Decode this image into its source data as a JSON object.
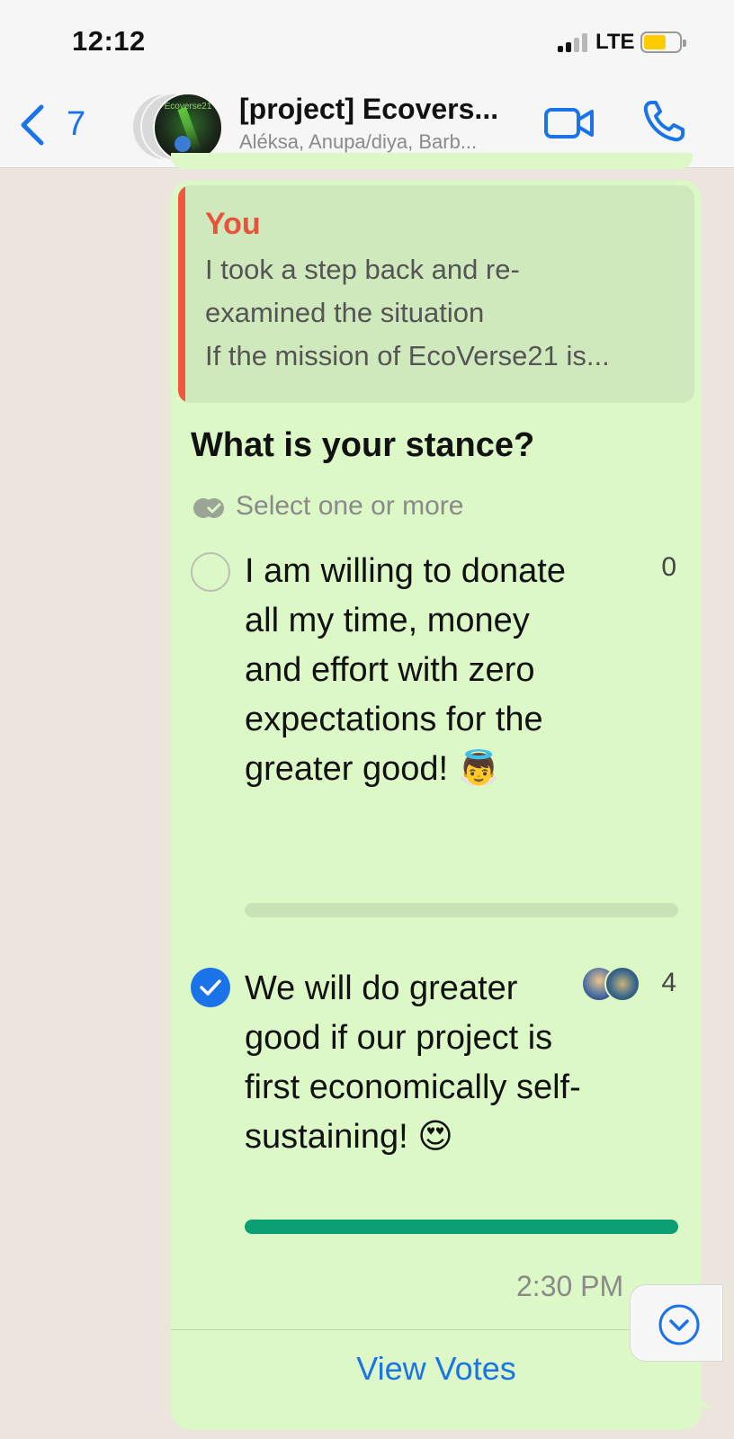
{
  "status_bar": {
    "time": "12:12",
    "carrier": "LTE",
    "battery_level": 0.62
  },
  "nav": {
    "back_count": "7",
    "avatar_text": "Ecoverse21",
    "title": "[project] Ecovers...",
    "subtitle": "Aléksa, Anupa/diya, Barb..."
  },
  "colors": {
    "accent": "#1a73e8",
    "bubble": "#dcf8c6",
    "quote_bar": "#f2573b",
    "vote_fill": "#0c9f74"
  },
  "message": {
    "quote": {
      "author": "You",
      "lines": [
        "I took a step back and re-",
        "examined the situation",
        "If the mission of EcoVerse21 is..."
      ]
    },
    "poll": {
      "question": "What is your stance?",
      "hint": "Select one or more",
      "options": [
        {
          "text": "I am willing to donate all my time, money and effort with zero expectations for the greater good! 👼",
          "count": "0",
          "checked": false,
          "fraction": 0
        },
        {
          "text": "We will do greater good if our project is first economically self-sustaining! 😍",
          "count": "4",
          "checked": true,
          "fraction": 1
        }
      ]
    },
    "time": "2:30 PM",
    "view_votes_label": "View Votes"
  },
  "icons": {
    "back": "chevron-left-icon",
    "video": "video-camera-icon",
    "call": "phone-icon",
    "hint": "double-check-icon",
    "scroll": "chevron-down-circle-icon"
  }
}
